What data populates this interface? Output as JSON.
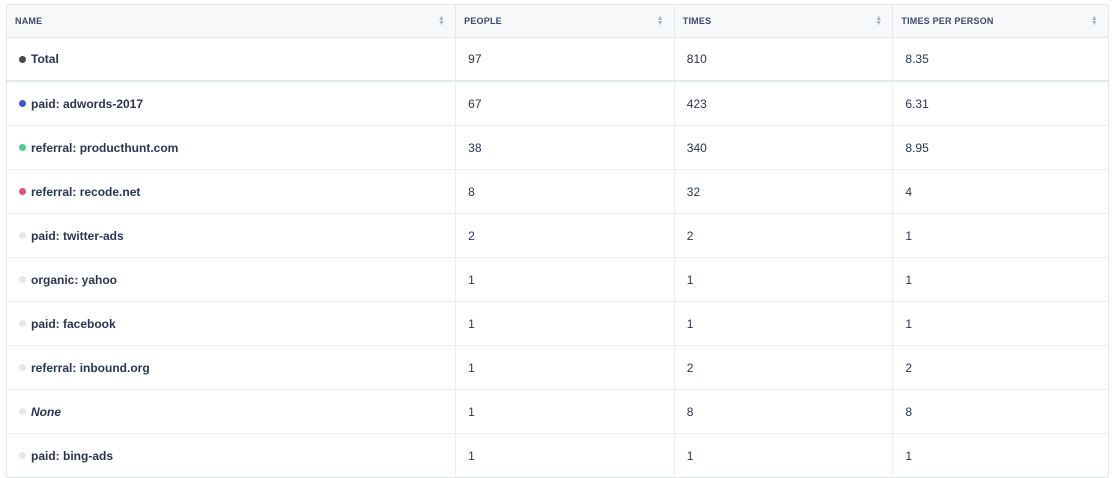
{
  "table": {
    "columns": [
      {
        "label": "NAME"
      },
      {
        "label": "PEOPLE"
      },
      {
        "label": "TIMES"
      },
      {
        "label": "TIMES PER PERSON"
      }
    ],
    "sort_icon": "sort-both-icon",
    "rows": [
      {
        "name": "Total",
        "people": "97",
        "times": "810",
        "per_person": "8.35",
        "dot_color": "#4a4a4a",
        "italic": false
      },
      {
        "name": "paid: adwords-2017",
        "people": "67",
        "times": "423",
        "per_person": "6.31",
        "dot_color": "#3f53d9",
        "italic": false
      },
      {
        "name": "referral: producthunt.com",
        "people": "38",
        "times": "340",
        "per_person": "8.95",
        "dot_color": "#4fc79a",
        "italic": false
      },
      {
        "name": "referral: recode.net",
        "people": "8",
        "times": "32",
        "per_person": "4",
        "dot_color": "#e84d86",
        "italic": false
      },
      {
        "name": "paid: twitter-ads",
        "people": "2",
        "times": "2",
        "per_person": "1",
        "dot_color": "#e6e7ea",
        "italic": false
      },
      {
        "name": "organic: yahoo",
        "people": "1",
        "times": "1",
        "per_person": "1",
        "dot_color": "#e6e7ea",
        "italic": false
      },
      {
        "name": "paid: facebook",
        "people": "1",
        "times": "1",
        "per_person": "1",
        "dot_color": "#e6e7ea",
        "italic": false
      },
      {
        "name": "referral: inbound.org",
        "people": "1",
        "times": "2",
        "per_person": "2",
        "dot_color": "#e6e7ea",
        "italic": false
      },
      {
        "name": "None",
        "people": "1",
        "times": "8",
        "per_person": "8",
        "dot_color": "#e6e7ea",
        "italic": true
      },
      {
        "name": "paid: bing-ads",
        "people": "1",
        "times": "1",
        "per_person": "1",
        "dot_color": "#e6e7ea",
        "italic": false
      }
    ]
  }
}
